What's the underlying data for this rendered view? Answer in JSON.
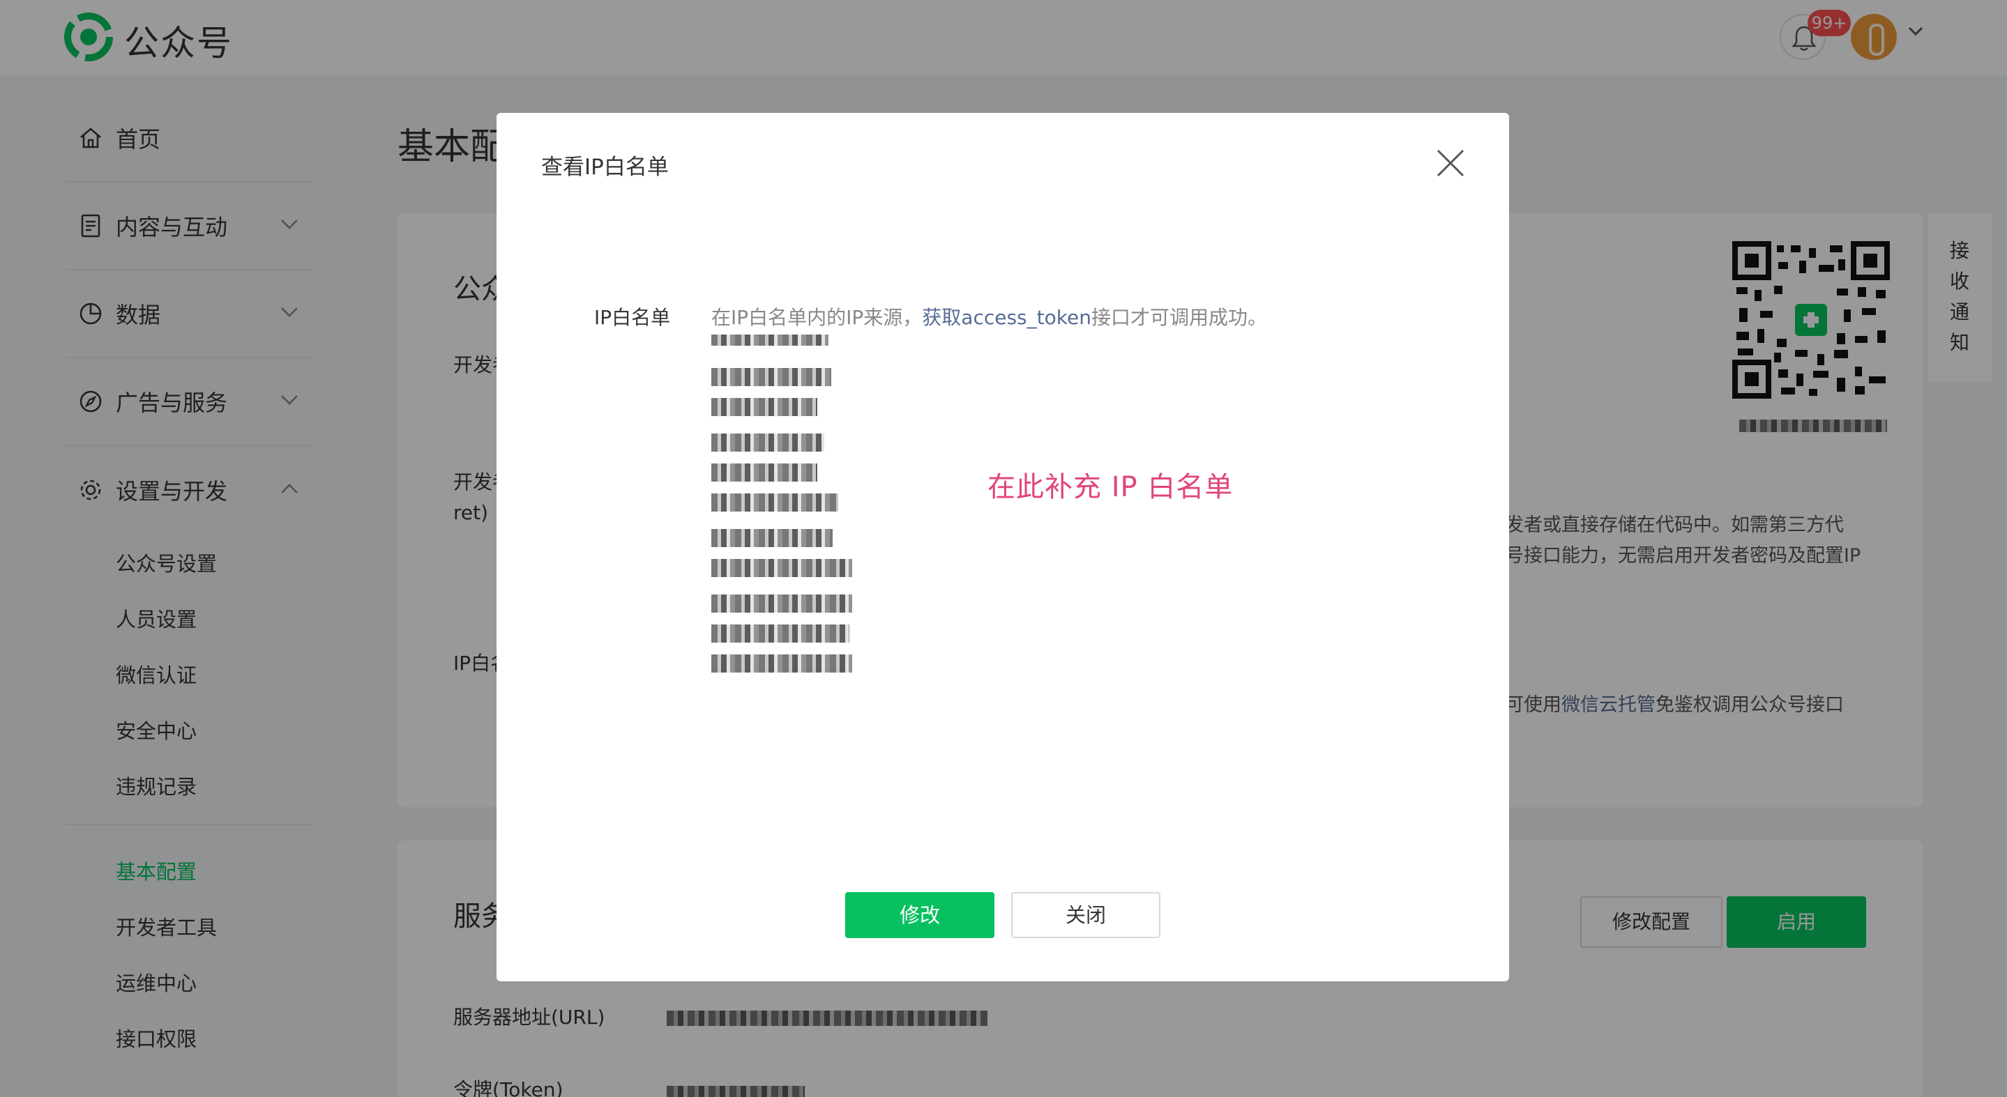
{
  "header": {
    "app_name": "公众号",
    "badge": "99+"
  },
  "sidebar": {
    "groups": [
      {
        "label": "首页",
        "icon": "home-icon"
      },
      {
        "label": "内容与互动",
        "icon": "document-icon"
      },
      {
        "label": "数据",
        "icon": "pie-chart-icon"
      },
      {
        "label": "广告与服务",
        "icon": "compass-icon"
      },
      {
        "label": "设置与开发",
        "icon": "gear-icon"
      }
    ],
    "settings_items": [
      "公众号设置",
      "人员设置",
      "微信认证",
      "安全中心",
      "违规记录"
    ],
    "dev_items": [
      "基本配置",
      "开发者工具",
      "运维中心",
      "接口权限"
    ]
  },
  "main": {
    "page_title": "基本配",
    "card1": {
      "title": "公众",
      "label_dev_id": "开发者",
      "label_dev_secret_1": "开发者",
      "label_dev_secret_2": "ret)",
      "label_ip": "IP白名",
      "secret_desc_1": "发者或直接存储在代码中。如需第三方代",
      "secret_desc_2": "号接口能力，无需启用开发者密码及配置IP",
      "ip_desc_prefix": "可使用",
      "ip_desc_link": "微信云托管",
      "ip_desc_suffix": "免鉴权调用公众号接口"
    },
    "qr_notify": "接收通知",
    "card2": {
      "title": "服务",
      "modify_button": "修改配置",
      "enable_button": "启用",
      "url_label": "服务器地址(URL)",
      "token_label": "令牌(Token)"
    }
  },
  "dialog": {
    "title": "查看IP白名单",
    "field_label": "IP白名单",
    "desc_prefix": "在IP白名单内的IP来源，",
    "desc_link": "获取access_token",
    "desc_suffix": "接口才可调用成功。",
    "hint": "在此补充 IP 白名单",
    "primary_button": "修改",
    "close_button": "关闭"
  },
  "colors": {
    "brand_green": "#07c160",
    "link": "#576b95",
    "badge_red": "#fa5151",
    "hint_pink": "#e0457b"
  }
}
